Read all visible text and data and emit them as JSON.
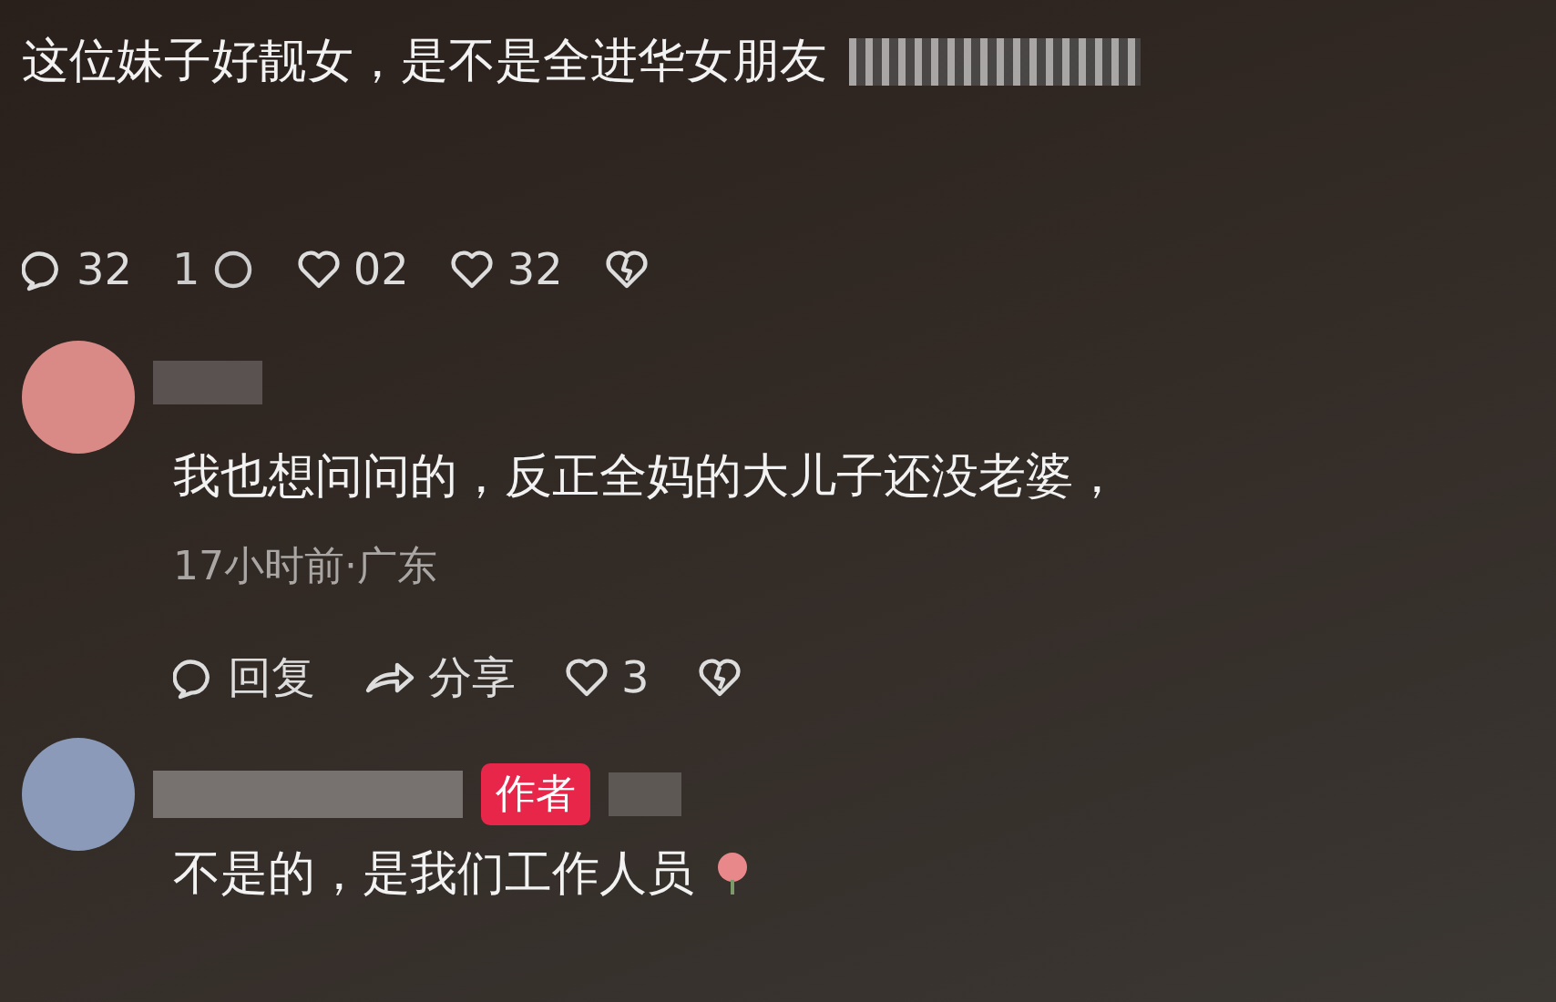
{
  "comments": [
    {
      "avatar": false,
      "text": "这位妹子好靓女，是不是全进华女朋友",
      "blurred_suffix": true,
      "actions": [
        {
          "kind": "comment",
          "label": "32"
        },
        {
          "kind": "text",
          "label": "1"
        },
        {
          "kind": "ring"
        },
        {
          "kind": "heart",
          "label": "02"
        },
        {
          "kind": "heart",
          "label": "32"
        },
        {
          "kind": "dislike"
        }
      ]
    },
    {
      "avatar": true,
      "author": false,
      "text": "我也想问问的，反正全妈的大儿子还没老婆，",
      "meta": "17小时前·广东",
      "actions": [
        {
          "kind": "comment",
          "label": "回复"
        },
        {
          "kind": "share",
          "label": "分享"
        },
        {
          "kind": "heart",
          "label": "3"
        },
        {
          "kind": "dislike"
        }
      ]
    },
    {
      "avatar": true,
      "author": true,
      "author_label": "作者",
      "text": "不是的，是我们工作人员",
      "emoji": true
    }
  ]
}
